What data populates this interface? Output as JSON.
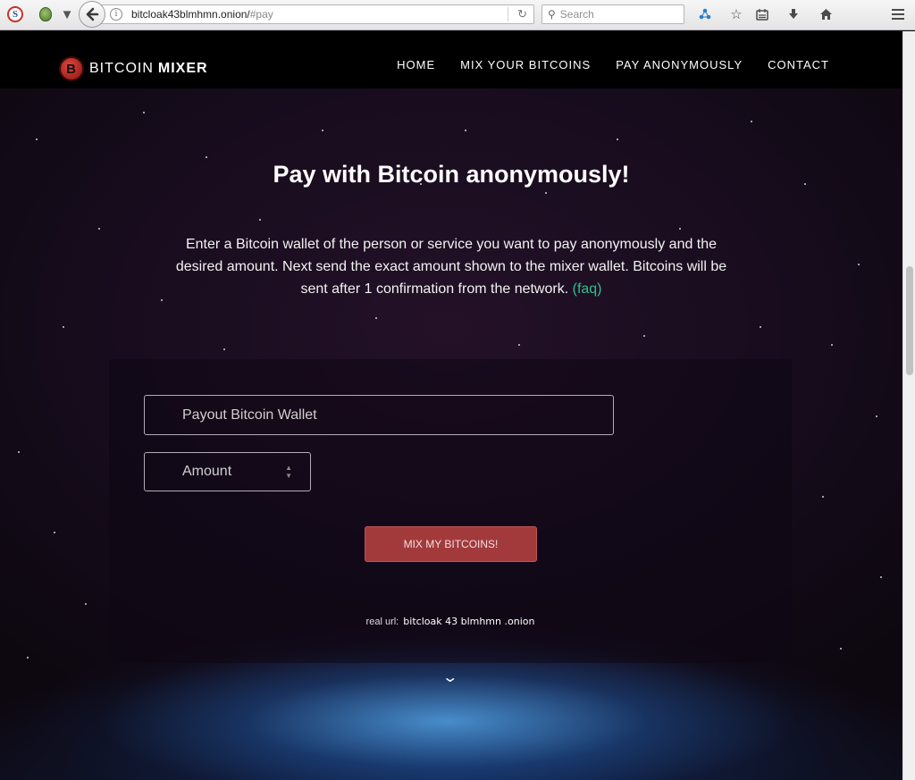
{
  "browser": {
    "url_host": "bitcloak43blmhmn.onion/",
    "url_path": "#pay",
    "search_placeholder": "Search"
  },
  "site": {
    "brand_regular": "BITCOIN",
    "brand_bold": "MIXER",
    "coin_symbol": "B",
    "nav": [
      "HOME",
      "MIX YOUR BITCOINS",
      "PAY ANONYMOUSLY",
      "CONTACT"
    ]
  },
  "hero": {
    "title": "Pay with Bitcoin anonymously!",
    "intro": "Enter a Bitcoin wallet of the person or service you want to pay anonymously and the desired amount. Next send the exact amount shown to the mixer wallet. Bitcoins will be sent after 1 confirmation from the network.",
    "faq_link": "(faq)"
  },
  "form": {
    "wallet_placeholder": "Payout Bitcoin Wallet",
    "amount_placeholder": "Amount",
    "submit_label": "MIX MY BITCOINS!",
    "real_url_label": "real url:",
    "real_url_value": "bitcloak 43 blmhmn .onion"
  },
  "colors": {
    "button": "#a23a3b",
    "faq_link": "#2fc08c",
    "navbar": "#000000"
  }
}
